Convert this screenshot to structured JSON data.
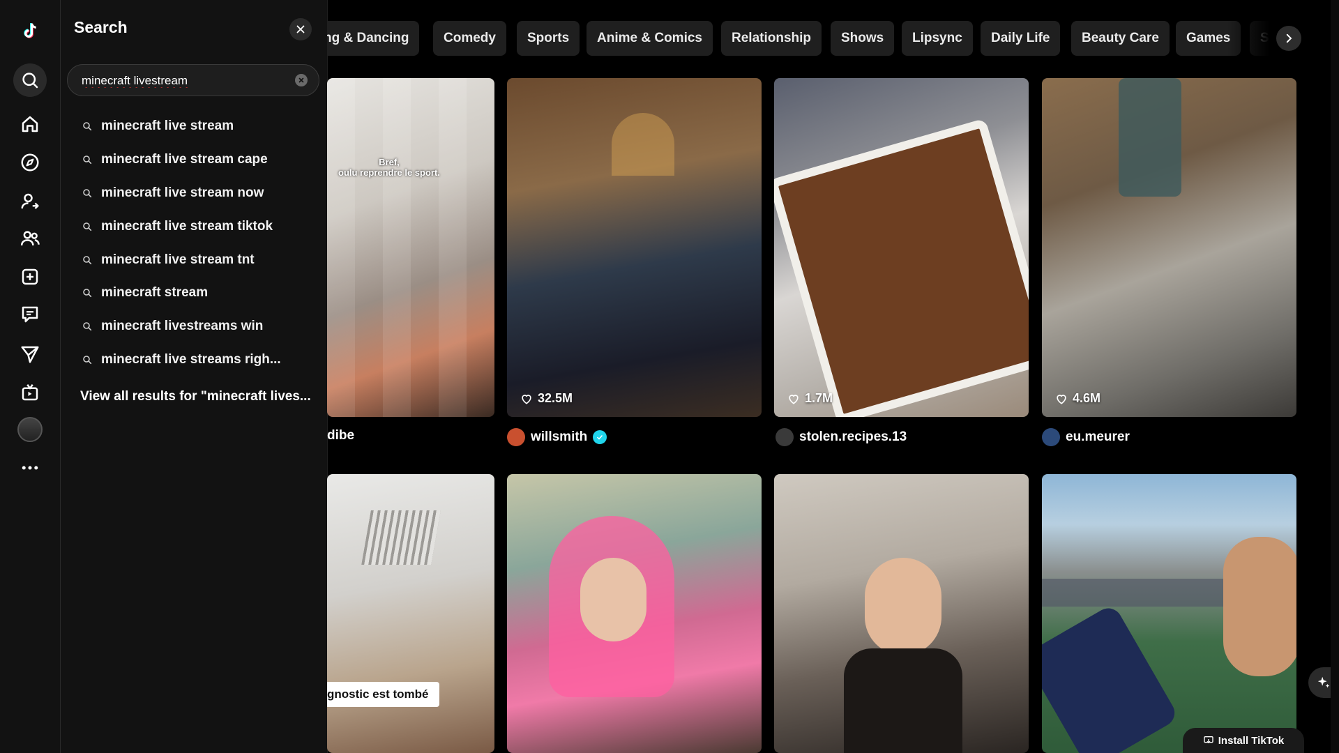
{
  "sidebar": {
    "icons": [
      "tiktok-logo-icon",
      "search-icon",
      "home-icon",
      "explore-icon",
      "following-icon",
      "friends-icon",
      "upload-icon",
      "messages-icon",
      "activity-icon",
      "live-icon",
      "profile-icon",
      "more-icon"
    ]
  },
  "search_panel": {
    "title": "Search",
    "query": "minecraft livestream",
    "suggestions": [
      "minecraft live stream",
      "minecraft live stream cape",
      "minecraft live stream now",
      "minecraft live stream tiktok",
      "minecraft live stream tnt",
      "minecraft stream",
      "minecraft livestreams win",
      "minecraft live streams righ..."
    ],
    "view_all": "View all results for \"minecraft lives..."
  },
  "categories": [
    "ng & Dancing",
    "Comedy",
    "Sports",
    "Anime & Comics",
    "Relationship",
    "Shows",
    "Lipsync",
    "Daily Life",
    "Beauty Care",
    "Games",
    "So"
  ],
  "videos": [
    {
      "author": "dibe",
      "likes": "",
      "overlay": "Bref,\noulu reprendre le sport."
    },
    {
      "author": "willsmith",
      "likes": "32.5M",
      "verified": true
    },
    {
      "author": "stolen.recipes.13",
      "likes": "1.7M"
    },
    {
      "author": "eu.meurer",
      "likes": "4.6M"
    },
    {
      "author": "",
      "likes": "",
      "overlay": "gnostic est tombé"
    },
    {
      "author": "",
      "likes": ""
    },
    {
      "author": "",
      "likes": ""
    },
    {
      "author": "",
      "likes": ""
    }
  ],
  "install_label": "Install TikTok",
  "colors": {
    "accent": "#20d5ec",
    "panel": "#121212",
    "chip": "#1f1f1f"
  }
}
